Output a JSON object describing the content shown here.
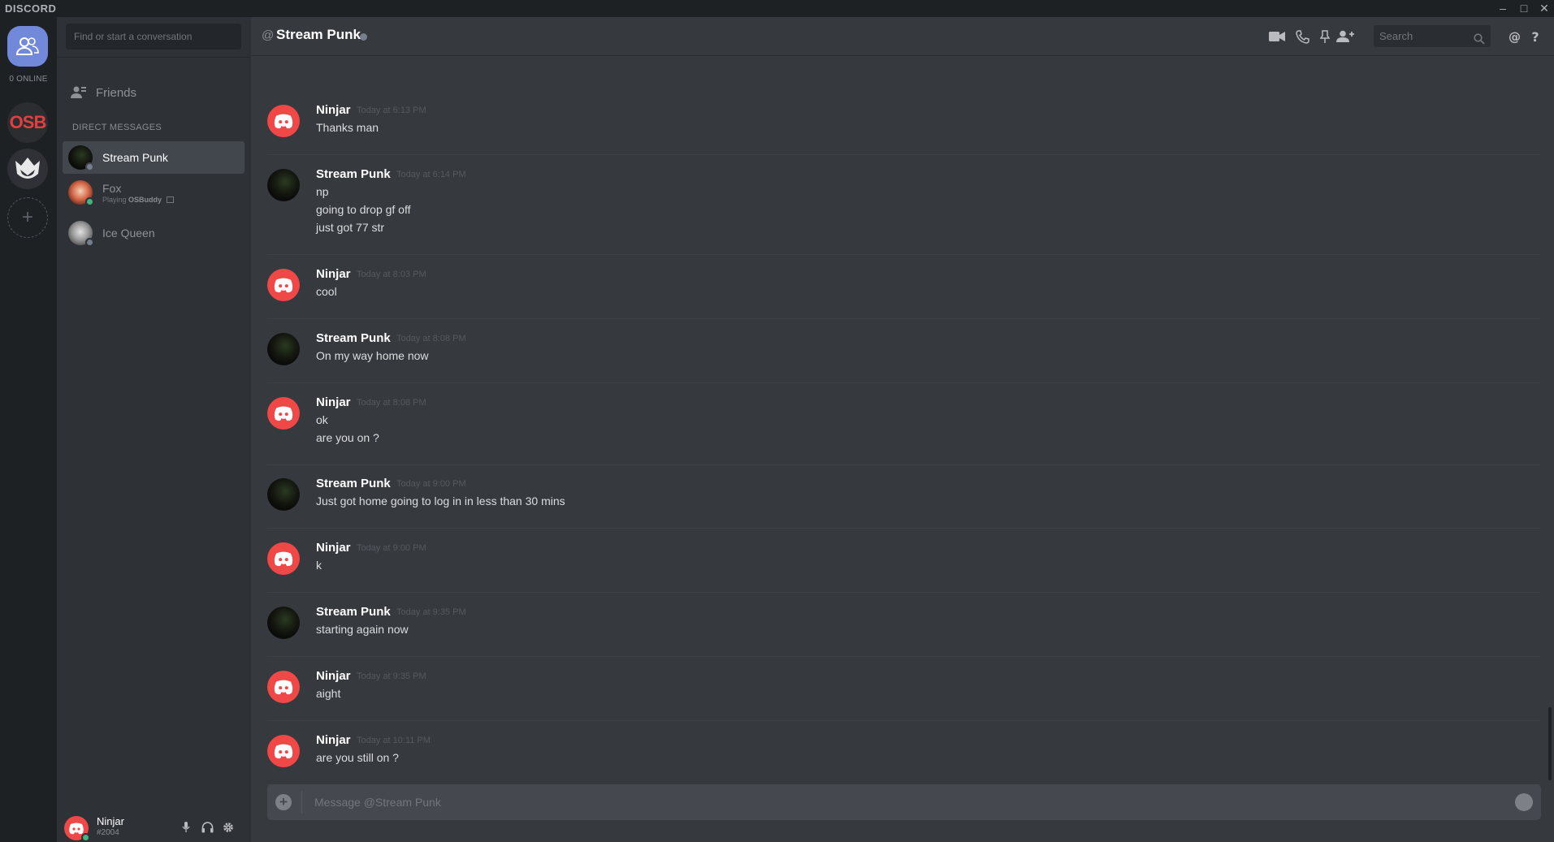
{
  "app": {
    "brand": "DISCORD"
  },
  "guilds": {
    "online_label": "0 ONLINE",
    "osb_label": "OSB",
    "add_label": "+"
  },
  "sidebar": {
    "search_placeholder": "Find or start a conversation",
    "friends_label": "Friends",
    "dm_header": "DIRECT MESSAGES",
    "dms": [
      {
        "name": "Stream Punk",
        "status": "offline",
        "active": true
      },
      {
        "name": "Fox",
        "status": "online",
        "activity_prefix": "Playing",
        "activity_game": "OSBuddy"
      },
      {
        "name": "Ice Queen",
        "status": "offline"
      }
    ]
  },
  "user": {
    "name": "Ninjar",
    "tag": "#2004",
    "status": "online"
  },
  "chat": {
    "at_symbol": "@",
    "title": "Stream Punk",
    "search_placeholder": "Search",
    "composer_placeholder": "Message @Stream Punk",
    "messages": [
      {
        "author": "Ninjar",
        "time": "Today at 6:13 PM",
        "lines": [
          "Thanks man"
        ]
      },
      {
        "author": "Stream Punk",
        "time": "Today at 6:14 PM",
        "lines": [
          "np",
          "going to drop gf off",
          "just got 77 str"
        ]
      },
      {
        "author": "Ninjar",
        "time": "Today at 8:03 PM",
        "lines": [
          "cool"
        ]
      },
      {
        "author": "Stream Punk",
        "time": "Today at 8:08 PM",
        "lines": [
          "On my way home now"
        ]
      },
      {
        "author": "Ninjar",
        "time": "Today at 8:08 PM",
        "lines": [
          "ok",
          "are you on ?"
        ]
      },
      {
        "author": "Stream Punk",
        "time": "Today at 9:00 PM",
        "lines": [
          "Just got home going to log in in less than 30 mins"
        ]
      },
      {
        "author": "Ninjar",
        "time": "Today at 9:00 PM",
        "lines": [
          "k"
        ]
      },
      {
        "author": "Stream Punk",
        "time": "Today at 9:35 PM",
        "lines": [
          "starting again now"
        ]
      },
      {
        "author": "Ninjar",
        "time": "Today at 9:35 PM",
        "lines": [
          "aight"
        ]
      },
      {
        "author": "Ninjar",
        "time": "Today at 10:11 PM",
        "lines": [
          "are you still on ?"
        ]
      }
    ]
  },
  "colors": {
    "blurple": "#7289da",
    "online": "#43b581",
    "offline": "#747f8d",
    "ninjar_avatar": "#f04747"
  },
  "icons": [
    "friends-icon",
    "video-call-icon",
    "phone-call-icon",
    "pin-icon",
    "add-friend-icon",
    "search-icon",
    "mention-icon",
    "help-icon",
    "microphone-icon",
    "headphones-icon",
    "settings-icon",
    "discord-logo-icon",
    "crest-icon",
    "emoji-icon"
  ]
}
